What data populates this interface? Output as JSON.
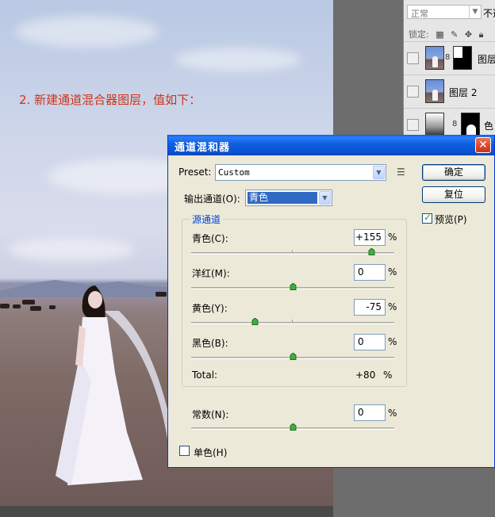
{
  "canvas": {
    "caption": "2. 新建通道混合器图层，值如下："
  },
  "layers_panel": {
    "blend_mode": "正常",
    "opacity_label": "不透",
    "lock_label": "锁定:",
    "lock_icons": [
      "transparency-lock-icon",
      "paint-lock-icon",
      "move-lock-icon",
      "padlock-icon"
    ],
    "layers": [
      {
        "name": "图层"
      },
      {
        "name": "图层 2"
      },
      {
        "name": "色"
      }
    ]
  },
  "dialog": {
    "title": "通道混和器",
    "close_glyph": "✕",
    "preset_label": "Preset:",
    "preset_value": "Custom",
    "output_channel_label": "输出通道(O):",
    "output_channel_value": "青色",
    "source_group_label": "源通道",
    "sliders": [
      {
        "label": "青色(C):",
        "value": "+155",
        "unit": "%",
        "number": 155
      },
      {
        "label": "洋红(M):",
        "value": "0",
        "unit": "%",
        "number": 0
      },
      {
        "label": "黄色(Y):",
        "value": "-75",
        "unit": "%",
        "number": -75
      },
      {
        "label": "黑色(B):",
        "value": "0",
        "unit": "%",
        "number": 0
      }
    ],
    "total_label": "Total:",
    "total_value": "+80",
    "total_unit": "%",
    "constant_label": "常数(N):",
    "constant_value": "0",
    "constant_unit": "%",
    "constant_number": 0,
    "mono_label": "单色(H)",
    "mono_checked": false,
    "ok_label": "确定",
    "reset_label": "复位",
    "preview_label": "预览(P)",
    "preview_checked": true
  }
}
